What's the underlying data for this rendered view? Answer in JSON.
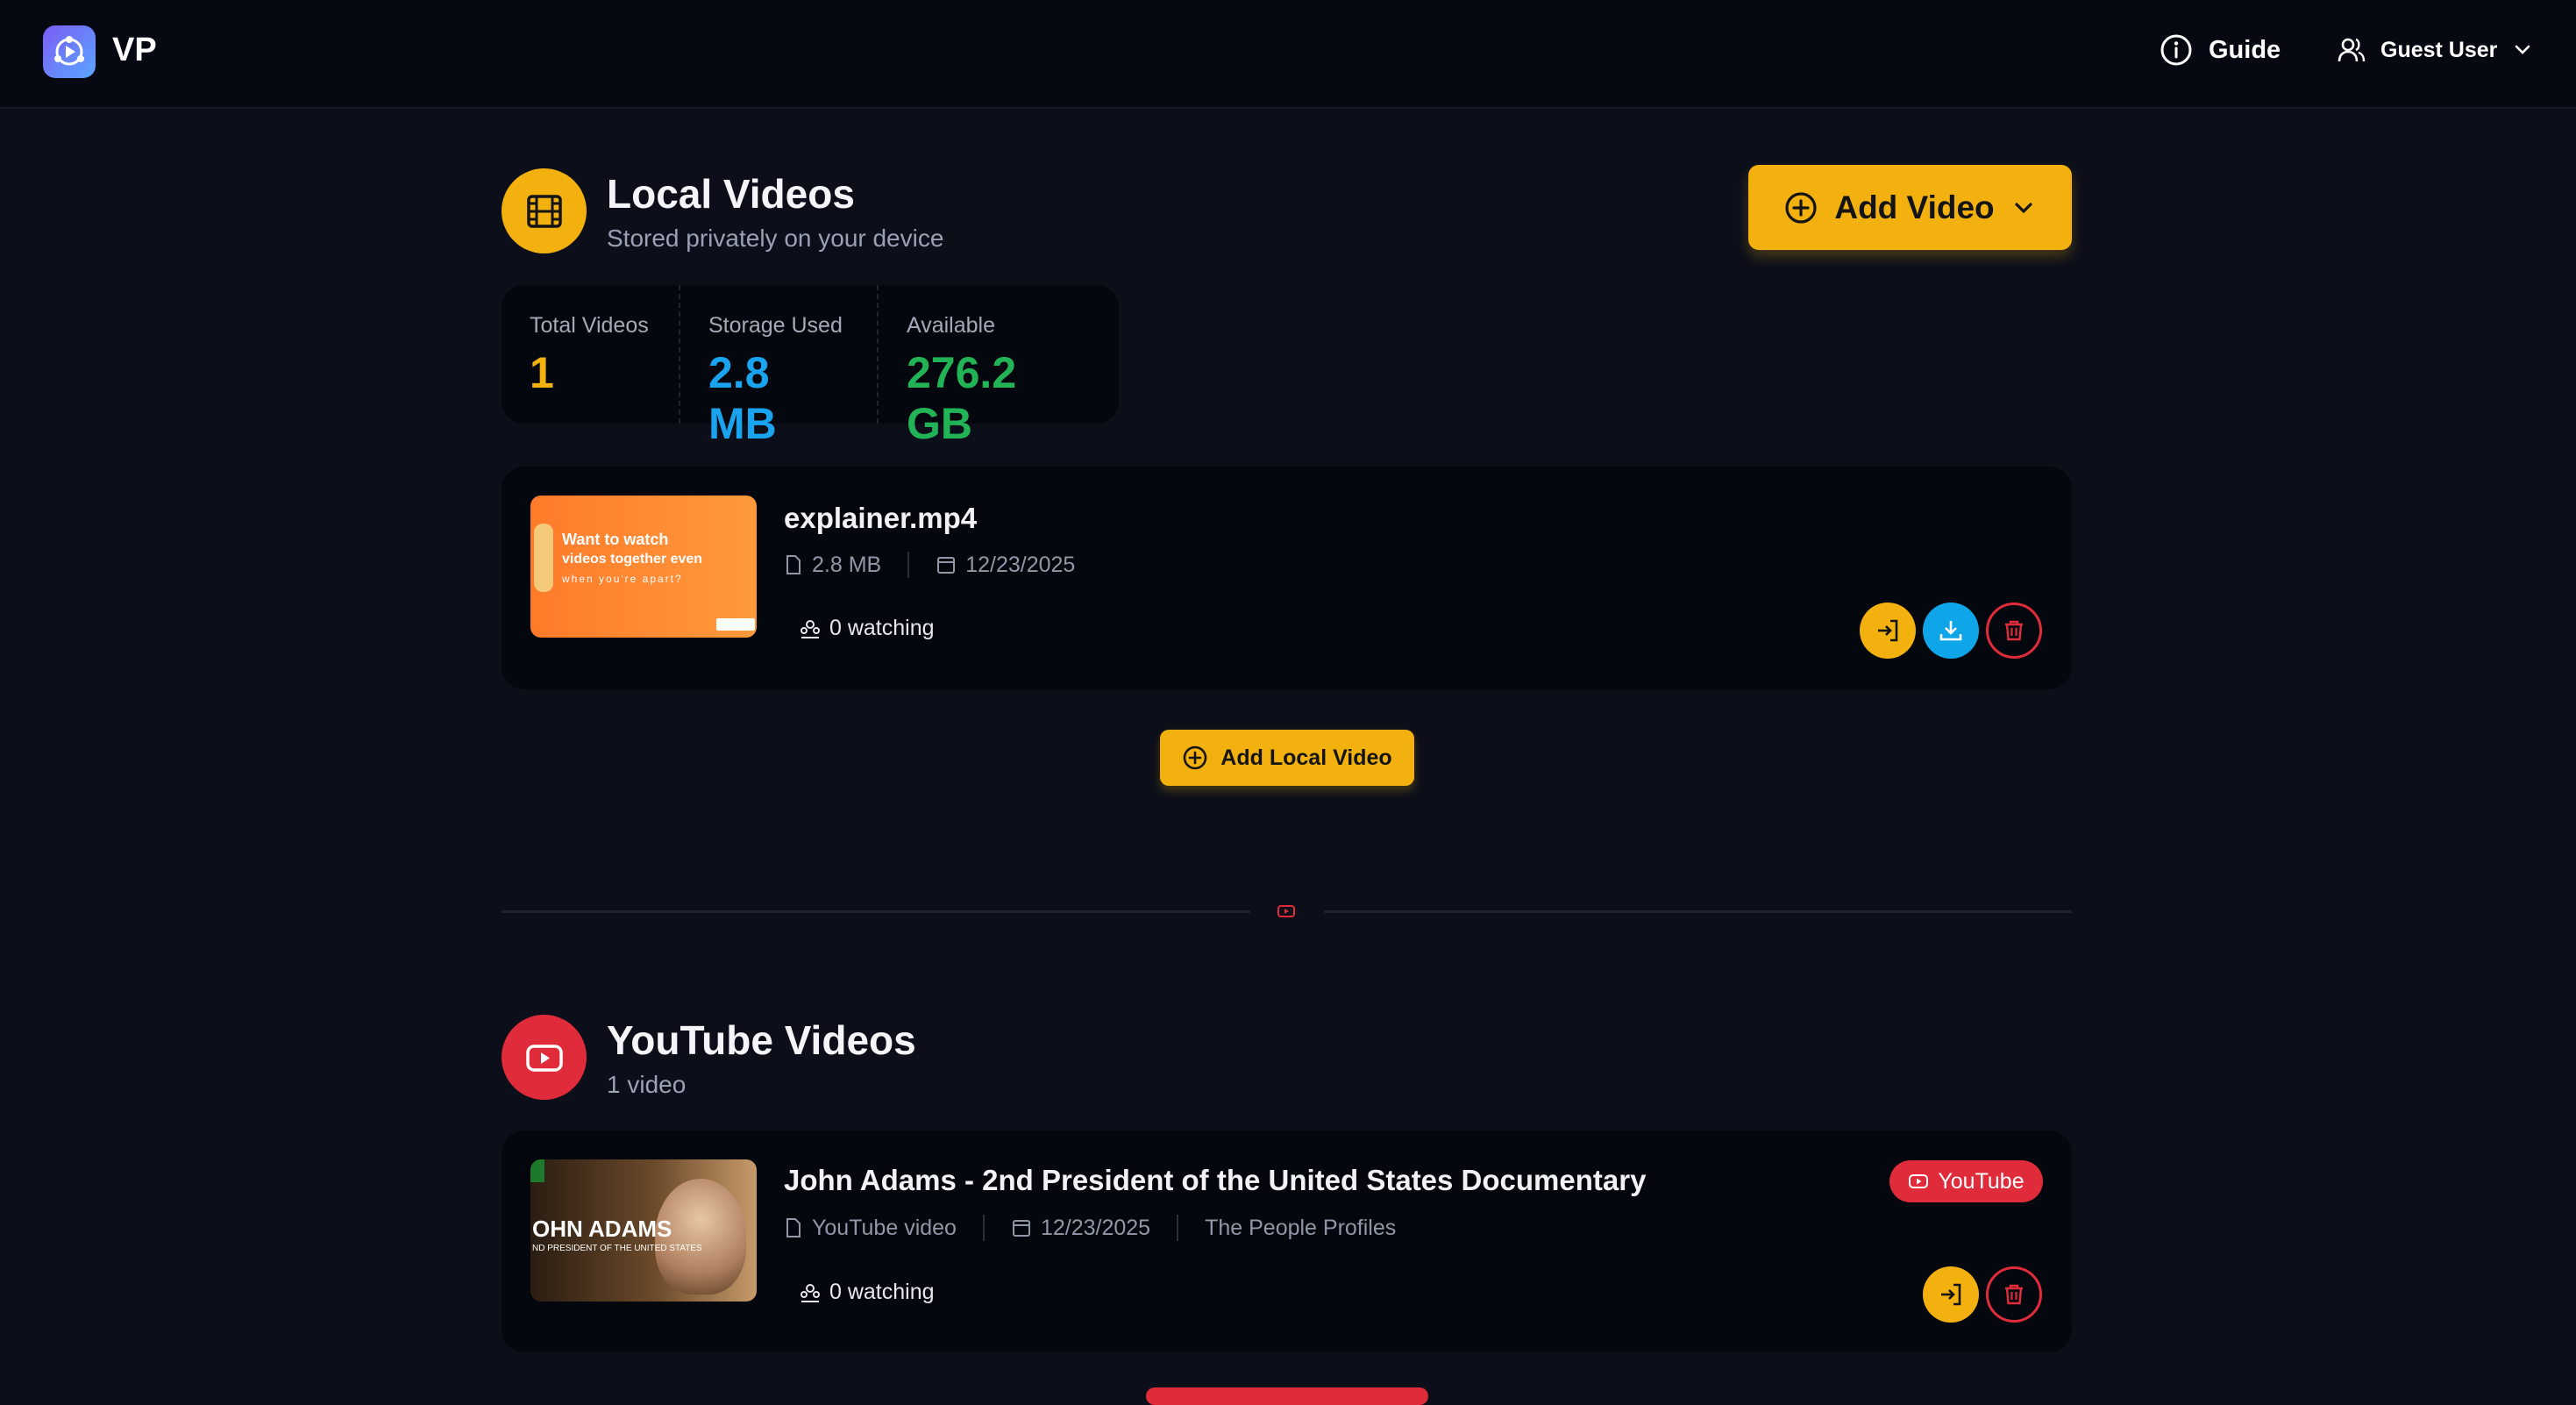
{
  "app": {
    "brand": "VP"
  },
  "header": {
    "guide_label": "Guide",
    "user_label": "Guest User"
  },
  "local": {
    "title": "Local Videos",
    "subtitle": "Stored privately on your device",
    "add_video_label": "Add Video",
    "stats": [
      {
        "label": "Total Videos",
        "value": "1",
        "color": "#f2b10f"
      },
      {
        "label": "Storage Used",
        "value": "2.8 MB",
        "color": "#1aa3ee"
      },
      {
        "label": "Available",
        "value": "276.2 GB",
        "color": "#22b356"
      }
    ],
    "video": {
      "title": "explainer.mp4",
      "size": "2.8 MB",
      "date": "12/23/2025",
      "watching": "0 watching",
      "thumb_text_1": "Want to watch",
      "thumb_text_2": "videos together even",
      "thumb_text_3": "when you're apart?"
    },
    "add_local_label": "Add Local Video"
  },
  "youtube": {
    "title": "YouTube Videos",
    "subtitle": "1 video",
    "video": {
      "title": "John Adams - 2nd President of the United States Documentary",
      "type": "YouTube video",
      "date": "12/23/2025",
      "channel": "The People Profiles",
      "watching": "0 watching",
      "badge": "YouTube",
      "thumb_text_1": "OHN ADAMS",
      "thumb_text_2": "ND PRESIDENT OF THE UNITED STATES"
    }
  }
}
